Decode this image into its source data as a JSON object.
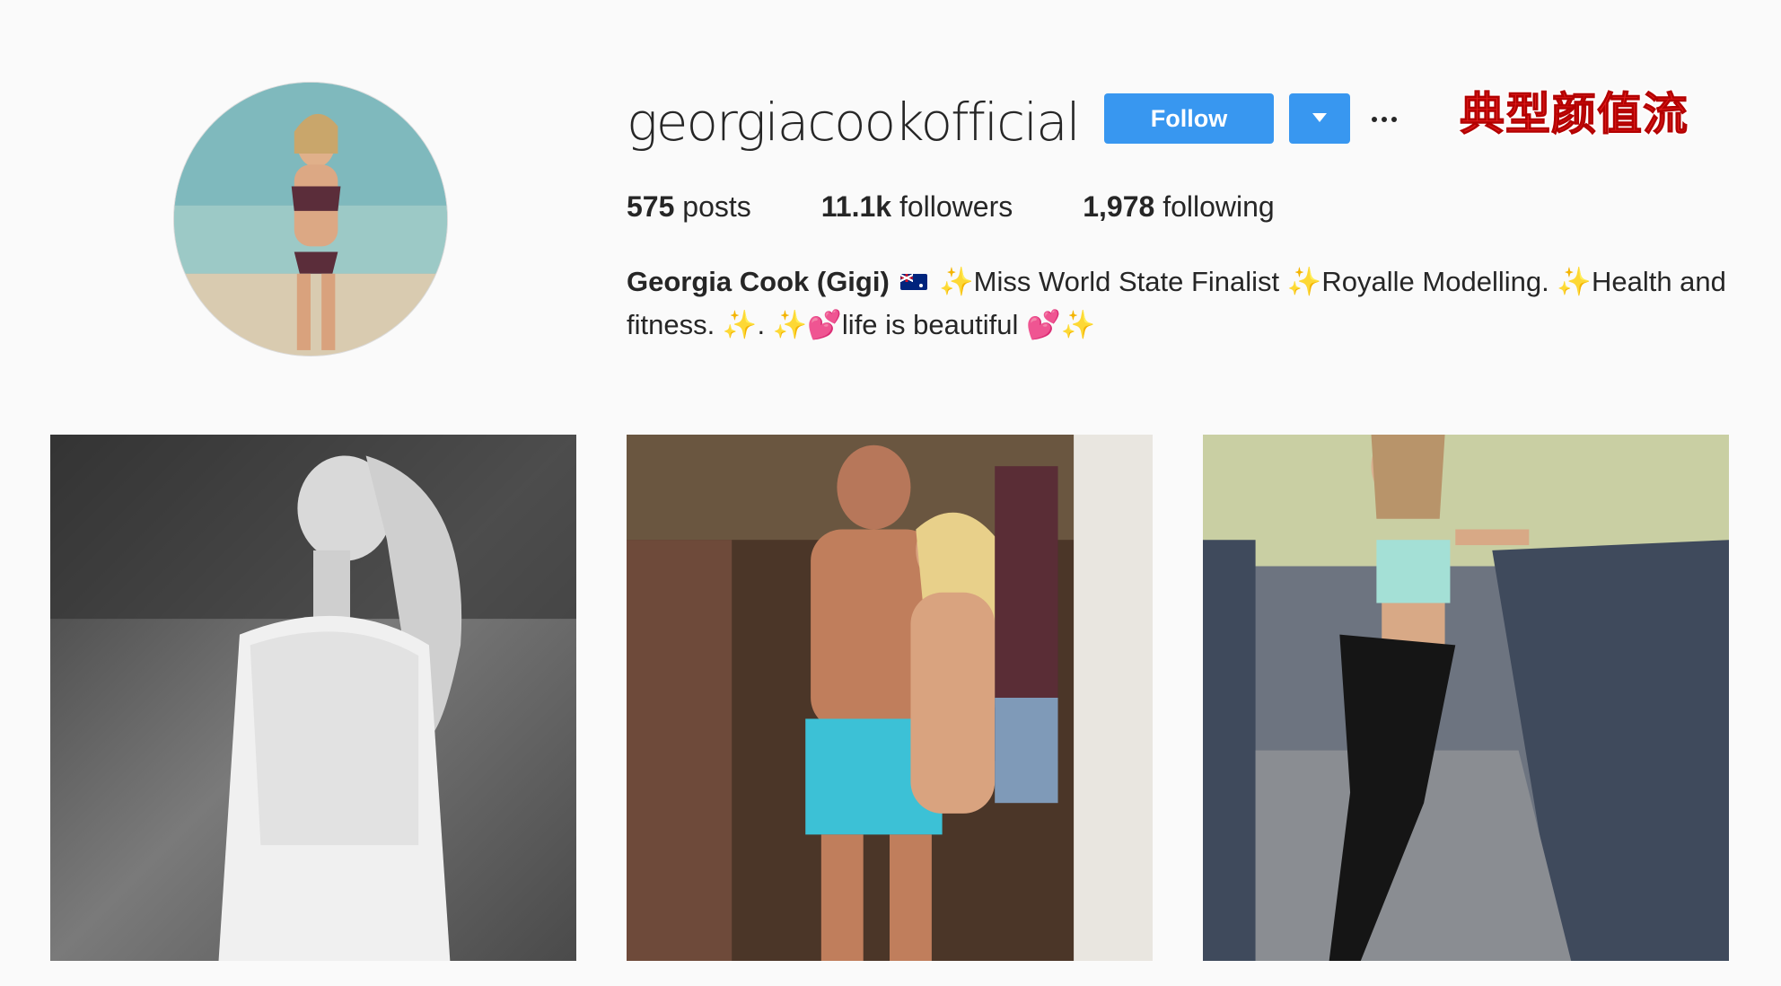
{
  "profile": {
    "username": "georgiacookofficial",
    "follow_label": "Follow",
    "overlay_tag": "典型颜值流"
  },
  "stats": {
    "posts_count": "575",
    "posts_label": "posts",
    "followers_count": "11.1k",
    "followers_label": "followers",
    "following_count": "1,978",
    "following_label": "following"
  },
  "bio": {
    "full_name": "Georgia Cook (Gigi)",
    "text_1": "Miss World State Finalist",
    "text_2": "Royalle Modelling.",
    "text_3": "Health and fitness.",
    "text_4": ".",
    "text_5": "life is beautiful",
    "sparkle": "✨",
    "heart": "💕"
  },
  "icons": {
    "flag": "australia-flag-icon",
    "more": "more-options-icon",
    "dropdown": "chevron-down-icon"
  },
  "colors": {
    "accent": "#3897f0",
    "background": "#fafafa",
    "text": "#262626",
    "overlay_red": "#e21d1d"
  }
}
